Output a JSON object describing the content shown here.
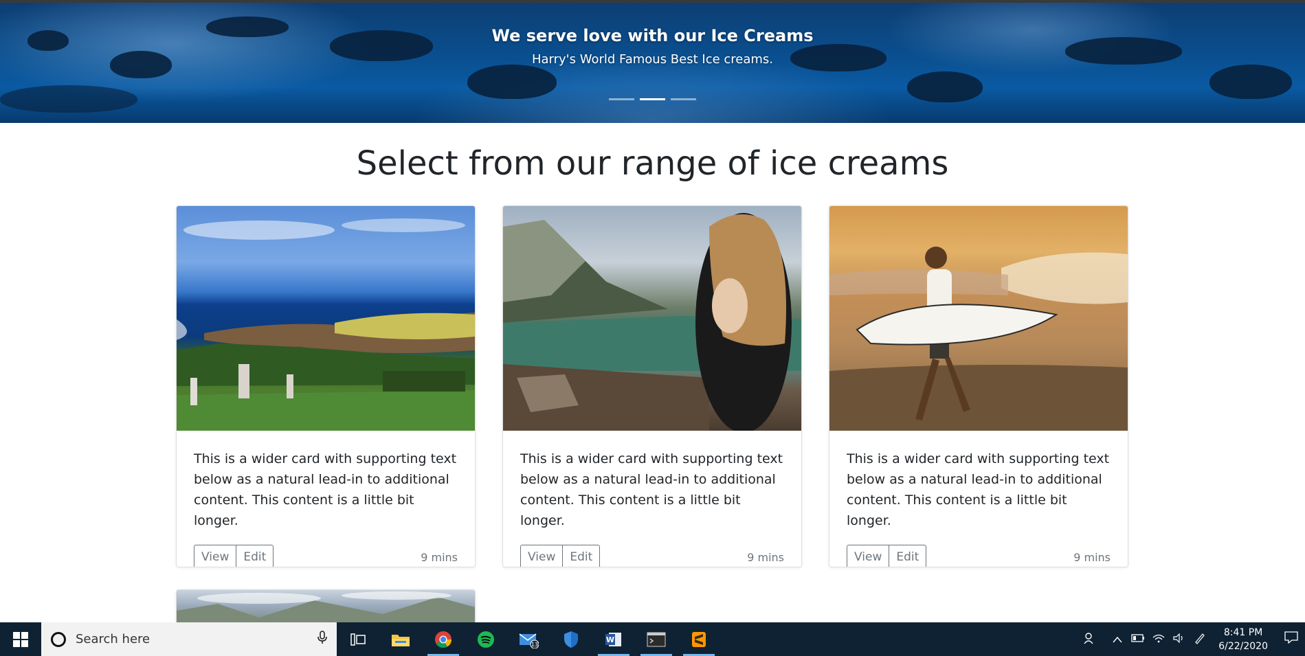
{
  "hero": {
    "title": "We serve love with our Ice Creams",
    "subtitle": "Harry's World Famous Best Ice creams.",
    "slides": 3,
    "active_slide": 2
  },
  "section": {
    "heading": "Select from our range of ice creams"
  },
  "cards": [
    {
      "scene": "coastal-cemetery",
      "text": "This is a wider card with supporting text below as a natural lead-in to additional content. This content is a little bit longer.",
      "view_label": "View",
      "edit_label": "Edit",
      "time": "9 mins"
    },
    {
      "scene": "woman-by-lake",
      "text": "This is a wider card with supporting text below as a natural lead-in to additional content. This content is a little bit longer.",
      "view_label": "View",
      "edit_label": "Edit",
      "time": "9 mins"
    },
    {
      "scene": "surfer-beach",
      "text": "This is a wider card with supporting text below as a natural lead-in to additional content. This content is a little bit longer.",
      "view_label": "View",
      "edit_label": "Edit",
      "time": "9 mins"
    }
  ],
  "taskbar": {
    "search_placeholder": "Search here",
    "mail_badge": "13",
    "time": "8:41 PM",
    "date": "6/22/2020",
    "apps": [
      "task-view",
      "file-explorer",
      "chrome",
      "spotify",
      "mail",
      "windows-defender",
      "word",
      "terminal",
      "sublime-text"
    ]
  },
  "colors": {
    "hero_blue": "#0a4f8f",
    "taskbar": "#0f2233",
    "button_border": "#6c757d",
    "accent_underline": "#76b9ed"
  }
}
